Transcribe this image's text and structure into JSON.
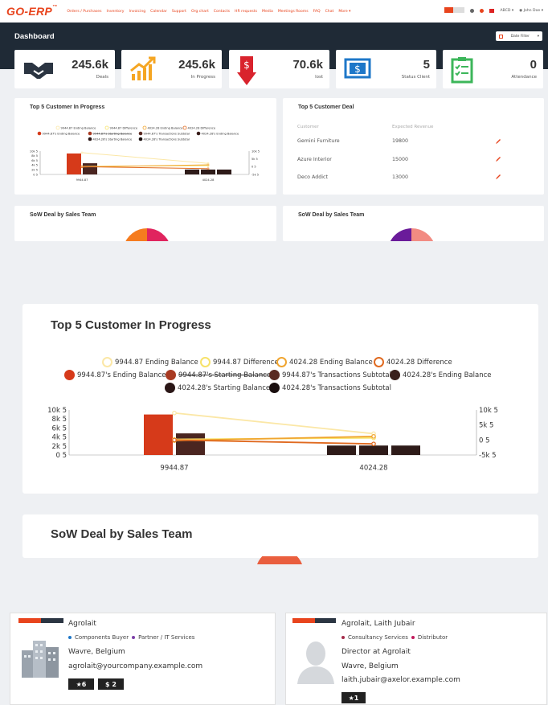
{
  "nav": {
    "logo": "GO-ERP",
    "links": [
      "Orders / Purchases",
      "Inventory",
      "Invoicing",
      "Calendar",
      "Support",
      "Org chart",
      "Contacts",
      "HR requests",
      "Media",
      "Meetings Rooms",
      "FAQ",
      "Chat",
      "More ▾"
    ],
    "company": "ABCD ▾",
    "user": "John Doe ▾"
  },
  "header": {
    "title": "Dashboard",
    "date_filter": "Date Filter"
  },
  "kpis": [
    {
      "value": "245.6k",
      "label": "Deals",
      "icon": "handshake-icon",
      "color": "#e8441d"
    },
    {
      "value": "245.6k",
      "label": "In Progress",
      "icon": "trend-up-icon",
      "color": "#f5a623"
    },
    {
      "value": "70.6k",
      "label": "lost",
      "icon": "dollar-down-icon",
      "color": "#d9232d"
    },
    {
      "value": "5",
      "label": "Status Client",
      "icon": "dollar-box-icon",
      "color": "#1e77c8"
    },
    {
      "value": "0",
      "label": "Attendance",
      "icon": "checklist-icon",
      "color": "#3cb65a"
    }
  ],
  "panels": {
    "progress_title": "Top 5 Customer In Progress",
    "deal_title": "Top 5 Customer Deal",
    "sow_title": "SoW Deal by Sales Team"
  },
  "deals": {
    "headers": [
      "Customer",
      "Expected Revenue"
    ],
    "rows": [
      {
        "customer": "Gemini Furniture",
        "revenue": "19800"
      },
      {
        "customer": "Azure Interior",
        "revenue": "15000"
      },
      {
        "customer": "Deco Addict",
        "revenue": "13000"
      }
    ]
  },
  "big": {
    "title": "Top 5 Customer In Progress",
    "sow_title": "SoW Deal by Sales Team"
  },
  "chart_data": {
    "type": "bar",
    "title": "Top 5 Customer In Progress",
    "categories": [
      "9944.87",
      "4024.28"
    ],
    "legend": [
      {
        "name": "9944.87 Ending Balance",
        "color": "#fbe7a6",
        "style": "ring"
      },
      {
        "name": "9944.87 Difference",
        "color": "#f7e26a",
        "style": "ring"
      },
      {
        "name": "4024.28 Ending Balance",
        "color": "#f0a530",
        "style": "ring"
      },
      {
        "name": "4024.28 Difference",
        "color": "#e06a20",
        "style": "ring"
      },
      {
        "name": "9944.87's Ending Balance",
        "color": "#d63a1a",
        "style": "dot"
      },
      {
        "name": "9944.87's Starting Balance",
        "color": "#a83a22",
        "style": "dot",
        "hidden": true
      },
      {
        "name": "9944.87's Transactions Subtotal",
        "color": "#5a2a22",
        "style": "dot"
      },
      {
        "name": "4024.28's Ending Balance",
        "color": "#3a1f1c",
        "style": "dot"
      },
      {
        "name": "4024.28's Starting Balance",
        "color": "#2a1616",
        "style": "dot"
      },
      {
        "name": "4024.28's Transactions Subtotal",
        "color": "#1a0f0f",
        "style": "dot"
      }
    ],
    "bars": [
      {
        "category": "9944.87",
        "series": "9944.87's Ending Balance",
        "value": 9000,
        "color": "#d63a1a"
      },
      {
        "category": "9944.87",
        "series": "9944.87's Transactions Subtotal",
        "value": 4800,
        "color": "#4a2520"
      },
      {
        "category": "4024.28",
        "series": "4024.28's Ending Balance",
        "value": 2100,
        "color": "#2e1b19"
      },
      {
        "category": "4024.28",
        "series": "4024.28's Starting Balance",
        "value": 2100,
        "color": "#2e1b19"
      },
      {
        "category": "4024.28",
        "series": "4024.28's Transactions Subtotal",
        "value": 2100,
        "color": "#2e1b19"
      }
    ],
    "lines": [
      {
        "name": "9944.87 Ending Balance",
        "color": "#fbe7a6",
        "points": [
          9000,
          2100
        ]
      },
      {
        "name": "9944.87 Difference",
        "color": "#f7e26a",
        "points": [
          200,
          700
        ]
      },
      {
        "name": "4024.28 Ending Balance",
        "color": "#f0a530",
        "points": [
          -200,
          1200
        ]
      },
      {
        "name": "4024.28 Difference",
        "color": "#e06a20",
        "points": [
          0,
          -1300
        ]
      }
    ],
    "yleft": {
      "ticks": [
        "10k 5",
        "8k 5",
        "6k 5",
        "4k 5",
        "2k 5",
        "0 5"
      ],
      "ylim": [
        0,
        10000
      ]
    },
    "yright": {
      "ticks": [
        "10k 5",
        "5k 5",
        "0 5",
        "-5k 5"
      ],
      "ylim": [
        -5000,
        10000
      ]
    }
  },
  "cards": [
    {
      "name": "Agrolait",
      "tags": [
        {
          "label": "Components Buyer",
          "color": "#1e77c8"
        },
        {
          "label": "Partner / IT Services",
          "color": "#7d3fa8"
        }
      ],
      "lines": [
        "Wavre, Belgium",
        "agrolait@yourcompany.example.com"
      ],
      "badges": [
        "★6",
        "$ 2"
      ],
      "avatar": "buildings-icon"
    },
    {
      "name": "Agrolait, Laith Jubair",
      "tags": [
        {
          "label": "Consultancy Services",
          "color": "#a52a4a"
        },
        {
          "label": "Distributor",
          "color": "#c2185b"
        }
      ],
      "lines": [
        "Director at Agrolait",
        "Wavre, Belgium",
        "laith.jubair@axelor.example.com"
      ],
      "badges": [
        "★1"
      ],
      "avatar": "person-silhouette-icon"
    }
  ]
}
